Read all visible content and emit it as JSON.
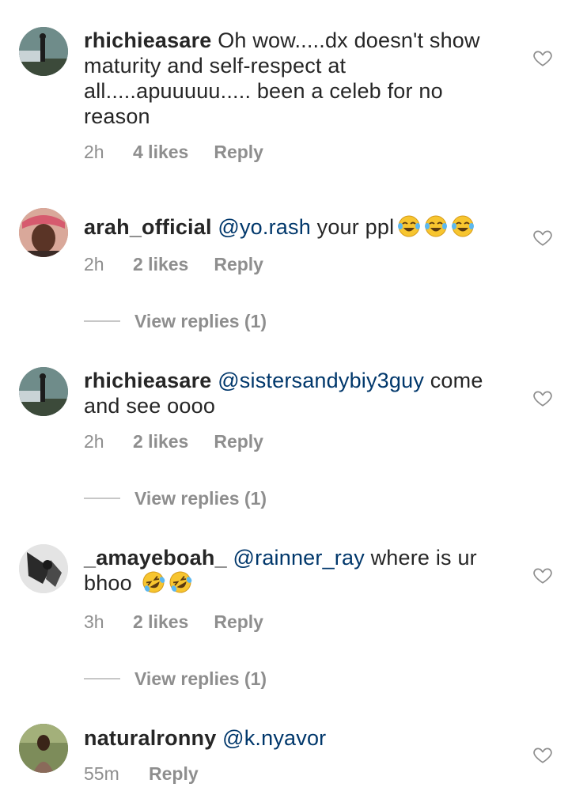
{
  "comments": [
    {
      "username": "rhichieasare",
      "text": "Oh wow.....dx doesn't show maturity and self-respect at all.....apuuuuu..... been a celeb for no reason",
      "time": "2h",
      "likes": "4 likes",
      "reply": "Reply"
    },
    {
      "username": "arah_official",
      "mention": "@yo.rash",
      "text": " your ppl",
      "emojis": [
        "face-with-tears-of-joy",
        "face-with-tears-of-joy",
        "face-with-tears-of-joy"
      ],
      "time": "2h",
      "likes": "2 likes",
      "reply": "Reply",
      "view_replies": "View replies (1)"
    },
    {
      "username": "rhichieasare",
      "mention": "@sistersandybiy3guy",
      "text": " come and see oooo",
      "time": "2h",
      "likes": "2 likes",
      "reply": "Reply",
      "view_replies": "View replies (1)"
    },
    {
      "username": "_amayeboah_",
      "mention": "@rainner_ray",
      "text": " where is ur bhoo ",
      "emojis": [
        "rolling-on-floor-laughing",
        "rolling-on-floor-laughing"
      ],
      "time": "3h",
      "likes": "2 likes",
      "reply": "Reply",
      "view_replies": "View replies (1)"
    },
    {
      "username": "naturalronny",
      "mention": "@k.nyavor",
      "time": "55m",
      "reply": "Reply"
    }
  ],
  "colors": {
    "text": "#262626",
    "secondary": "#8e8e8e",
    "mention": "#00376b"
  }
}
